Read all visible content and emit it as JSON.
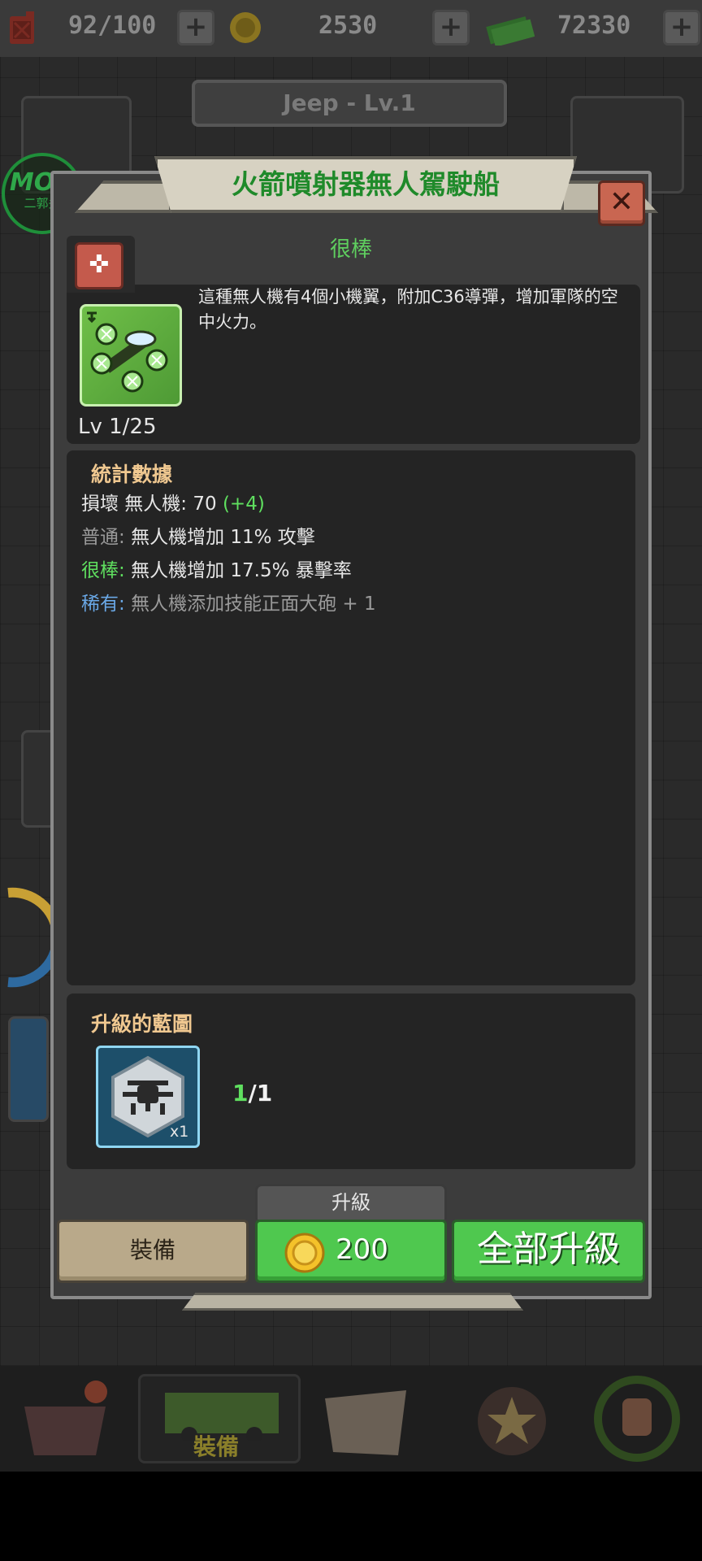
{
  "topbar": {
    "fuel": "92/100",
    "coins": "2530",
    "cash": "72330",
    "icons": [
      "fuel-can-icon",
      "gold-coin-icon",
      "cash-icon"
    ]
  },
  "background": {
    "vehicle_title": "Jeep - Lv.1",
    "watermark_top": "MOD",
    "watermark_bottom": "二郭头",
    "nav_active_label": "裝備"
  },
  "modal": {
    "title": "火箭噴射器無人駕駛船",
    "rarity": "很棒",
    "description": "這種無人機有4個小機翼，附加C36導彈，增加軍隊的空中火力。",
    "level": "Lv 1/25",
    "stats": {
      "heading": "統計數據",
      "damage": {
        "label": "損壞 無人機: 70",
        "bonus": "(+4)"
      },
      "common": {
        "tag": "普通:",
        "text": "無人機增加 11% 攻擊"
      },
      "great": {
        "tag": "很棒:",
        "text": "無人機增加 17.5% 暴擊率"
      },
      "rare": {
        "tag": "稀有:",
        "text": "無人機添加技能正面大砲 + 1"
      }
    },
    "blueprint": {
      "heading": "升級的藍圖",
      "card_qty": "x1",
      "owned": "1",
      "needed": "/1"
    },
    "buttons": {
      "equip": "裝備",
      "upgrade_header": "升級",
      "upgrade_cost": "200",
      "upgrade_all": "全部升級"
    }
  },
  "colors": {
    "title_green": "#1f8a2a",
    "button_green": "#4fc84f",
    "stat_heading": "#f0c890",
    "rare_blue": "#6aa8e6"
  }
}
